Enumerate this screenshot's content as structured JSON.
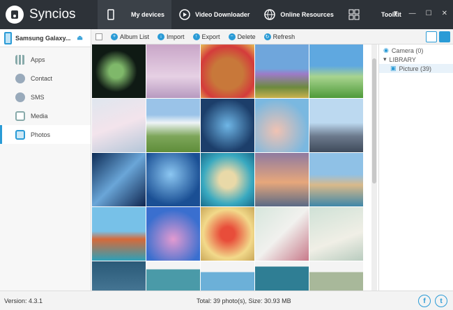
{
  "app": {
    "title": "Syncios"
  },
  "nav": {
    "tabs": [
      {
        "label": "My devices",
        "icon": "phone-icon"
      },
      {
        "label": "Video Downloader",
        "icon": "play-icon"
      },
      {
        "label": "Online Resources",
        "icon": "globe-icon"
      },
      {
        "label": "Toolkit",
        "icon": "grid-icon"
      }
    ]
  },
  "sidebar": {
    "device": "Samsung Galaxy...",
    "items": [
      {
        "label": "Apps"
      },
      {
        "label": "Contact"
      },
      {
        "label": "SMS"
      },
      {
        "label": "Media"
      },
      {
        "label": "Photos"
      }
    ]
  },
  "toolbar": {
    "album_list": "Album List",
    "import": "Import",
    "export": "Export",
    "delete": "Delete",
    "refresh": "Refresh"
  },
  "tree": {
    "camera": "Camera (0)",
    "library": "LIBRARY",
    "picture": "Picture (39)"
  },
  "status": {
    "version": "Version: 4.3.1",
    "total": "Total: 39 photo(s), Size: 30.93 MB"
  },
  "colors": {
    "accent": "#2a9bd6",
    "topbar": "#2d3238"
  }
}
